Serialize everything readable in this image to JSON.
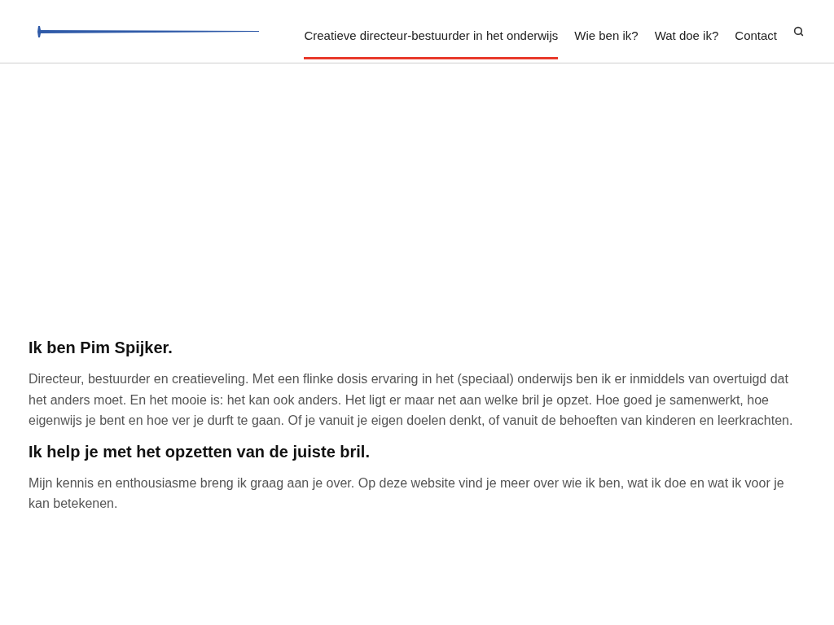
{
  "nav": {
    "items": [
      {
        "label": "Creatieve directeur-bestuurder in het onderwijs",
        "selected": true
      },
      {
        "label": "Wie ben ik?",
        "selected": false
      },
      {
        "label": "Wat doe ik?",
        "selected": false
      },
      {
        "label": "Contact",
        "selected": false
      }
    ]
  },
  "sections": [
    {
      "heading": "Ik ben Pim Spijker.",
      "text": "Directeur, bestuurder en creatieveling. Met een flinke dosis ervaring in het (speciaal) onderwijs ben ik er inmiddels van overtuigd dat het anders moet. En het mooie is: het kan ook anders. Het ligt er maar net aan welke bril je opzet. Hoe goed je samenwerkt, hoe eigenwijs je bent en hoe ver je durft te gaan. Of je vanuit je eigen doelen denkt, of vanuit de behoeften van kinderen en leerkrachten."
    },
    {
      "heading": "Ik help je met het opzetten van de juiste bril.",
      "text": "Mijn kennis en enthousiasme breng ik graag aan je over. Op deze website vind je meer over wie ik ben, wat ik doe en wat ik voor je kan betekenen."
    }
  ]
}
